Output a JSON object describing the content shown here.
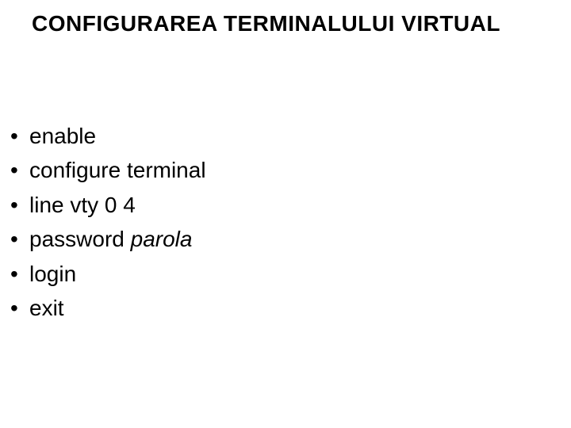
{
  "title": "CONFIGURAREA TERMINALULUI VIRTUAL",
  "items": [
    {
      "text": "enable"
    },
    {
      "text": "configure terminal"
    },
    {
      "text": "line vty 0 4"
    },
    {
      "prefix": "password ",
      "italic": "parola"
    },
    {
      "text": "login"
    },
    {
      "text": "exit"
    }
  ],
  "bullet": "•"
}
